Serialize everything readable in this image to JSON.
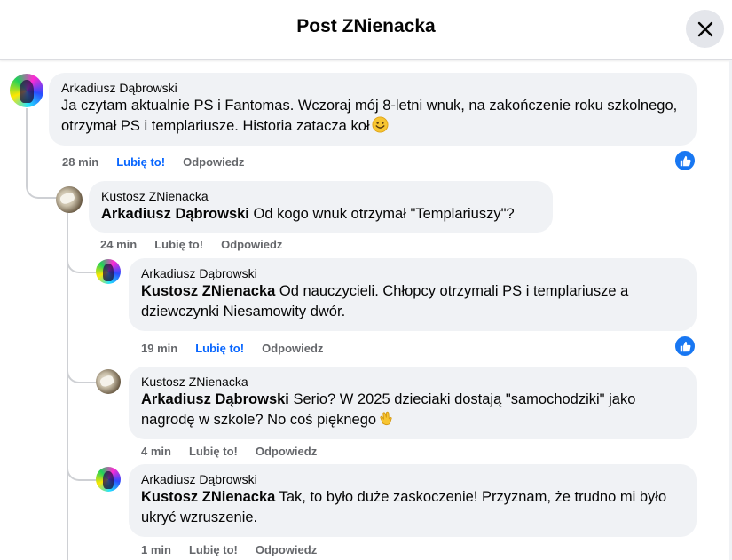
{
  "header": {
    "title": "Post ZNienacka"
  },
  "icons": {
    "close": "close-icon",
    "like": "thumbs-up-icon"
  },
  "colors": {
    "accent": "#0866ff",
    "bubble": "#f0f2f5",
    "meta": "#65676b"
  },
  "comments": [
    {
      "author": "Arkadiusz Dąbrowski",
      "mention": "",
      "text": "Ja czytam aktualnie PS i Fantomas. Wczoraj mój 8-letni wnuk, na zakończenie roku szkolnego, otrzymał PS i templariusze. Historia zatacza koł",
      "emoji": "slightly-smiling-face",
      "time": "28 min",
      "like_label": "Lubię to!",
      "reply_label": "Odpowiedz",
      "has_reaction": true
    },
    {
      "author": "Kustosz ZNienacka",
      "mention": "Arkadiusz Dąbrowski",
      "text": "Od kogo wnuk otrzymał \"Templariuszy\"?",
      "time": "24 min",
      "like_label": "Lubię to!",
      "reply_label": "Odpowiedz",
      "has_reaction": false
    },
    {
      "author": "Arkadiusz Dąbrowski",
      "mention": "Kustosz ZNienacka",
      "text": "Od nauczycieli. Chłopcy otrzymali PS i templariusze a dziewczynki Niesamowity dwór.",
      "time": "19 min",
      "like_label": "Lubię to!",
      "reply_label": "Odpowiedz",
      "has_reaction": true
    },
    {
      "author": "Kustosz ZNienacka",
      "mention": "Arkadiusz Dąbrowski",
      "text": "Serio? W 2025 dzieciaki dostają \"samochodziki\" jako nagrodę w szkole? No coś pięknego",
      "emoji": "clapping-hands",
      "time": "4 min",
      "like_label": "Lubię to!",
      "reply_label": "Odpowiedz",
      "has_reaction": false
    },
    {
      "author": "Arkadiusz Dąbrowski",
      "mention": "Kustosz ZNienacka",
      "text": "Tak, to było duże zaskoczenie! Przyznam, że trudno mi było ukryć wzruszenie.",
      "time": "1 min",
      "like_label": "Lubię to!",
      "reply_label": "Odpowiedz",
      "has_reaction": false
    }
  ]
}
